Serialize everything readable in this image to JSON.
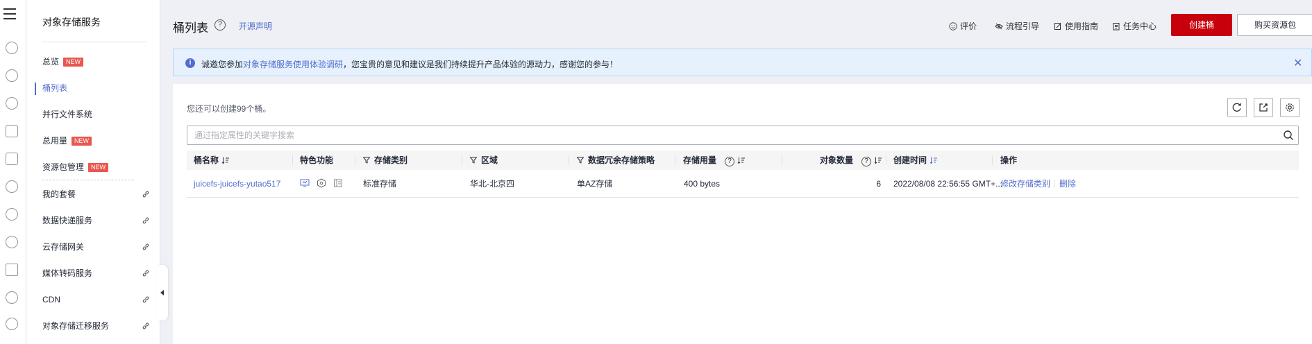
{
  "sidebar": {
    "title": "对象存储服务",
    "items": [
      {
        "label": "总览",
        "badge": "NEW"
      },
      {
        "label": "桶列表"
      },
      {
        "label": "并行文件系统"
      },
      {
        "label": "总用量",
        "badge": "NEW"
      },
      {
        "label": "资源包管理",
        "badge": "NEW"
      },
      {
        "label": "我的套餐"
      },
      {
        "label": "数据快递服务"
      },
      {
        "label": "云存储网关"
      },
      {
        "label": "媒体转码服务"
      },
      {
        "label": "CDN"
      },
      {
        "label": "对象存储迁移服务"
      }
    ]
  },
  "header": {
    "title": "桶列表",
    "help": "?",
    "open_source": "开源声明",
    "links": [
      "评价",
      "流程引导",
      "使用指南",
      "任务中心"
    ],
    "create_button": "创建桶",
    "buy_button": "购买资源包"
  },
  "notice": {
    "prefix": "诚邀您参加",
    "link": "对象存储服务使用体验调研",
    "suffix": "，您宝贵的意见和建议是我们持续提升产品体验的源动力，感谢您的参与！",
    "close": "✕"
  },
  "main": {
    "hint": "您还可以创建99个桶。",
    "search_placeholder": "通过指定属性的关键字搜索",
    "columns": [
      "桶名称",
      "特色功能",
      "存储类别",
      "区域",
      "数据冗余存储策略",
      "存储用量",
      "对象数量",
      "创建时间",
      "操作"
    ],
    "rows": [
      {
        "name": "juicefs-juicefs-yutao517",
        "storage_class": "标准存储",
        "region": "华北-北京四",
        "redundancy": "单AZ存储",
        "usage": "400 bytes",
        "objects": "6",
        "created": "2022/08/08 22:56:55 GMT+...",
        "op_modify": "修改存储类别",
        "op_delete": "删除"
      }
    ]
  },
  "colors": {
    "accent": "#526ecc",
    "brand": "#c7000b",
    "badge": "#e8584f"
  }
}
